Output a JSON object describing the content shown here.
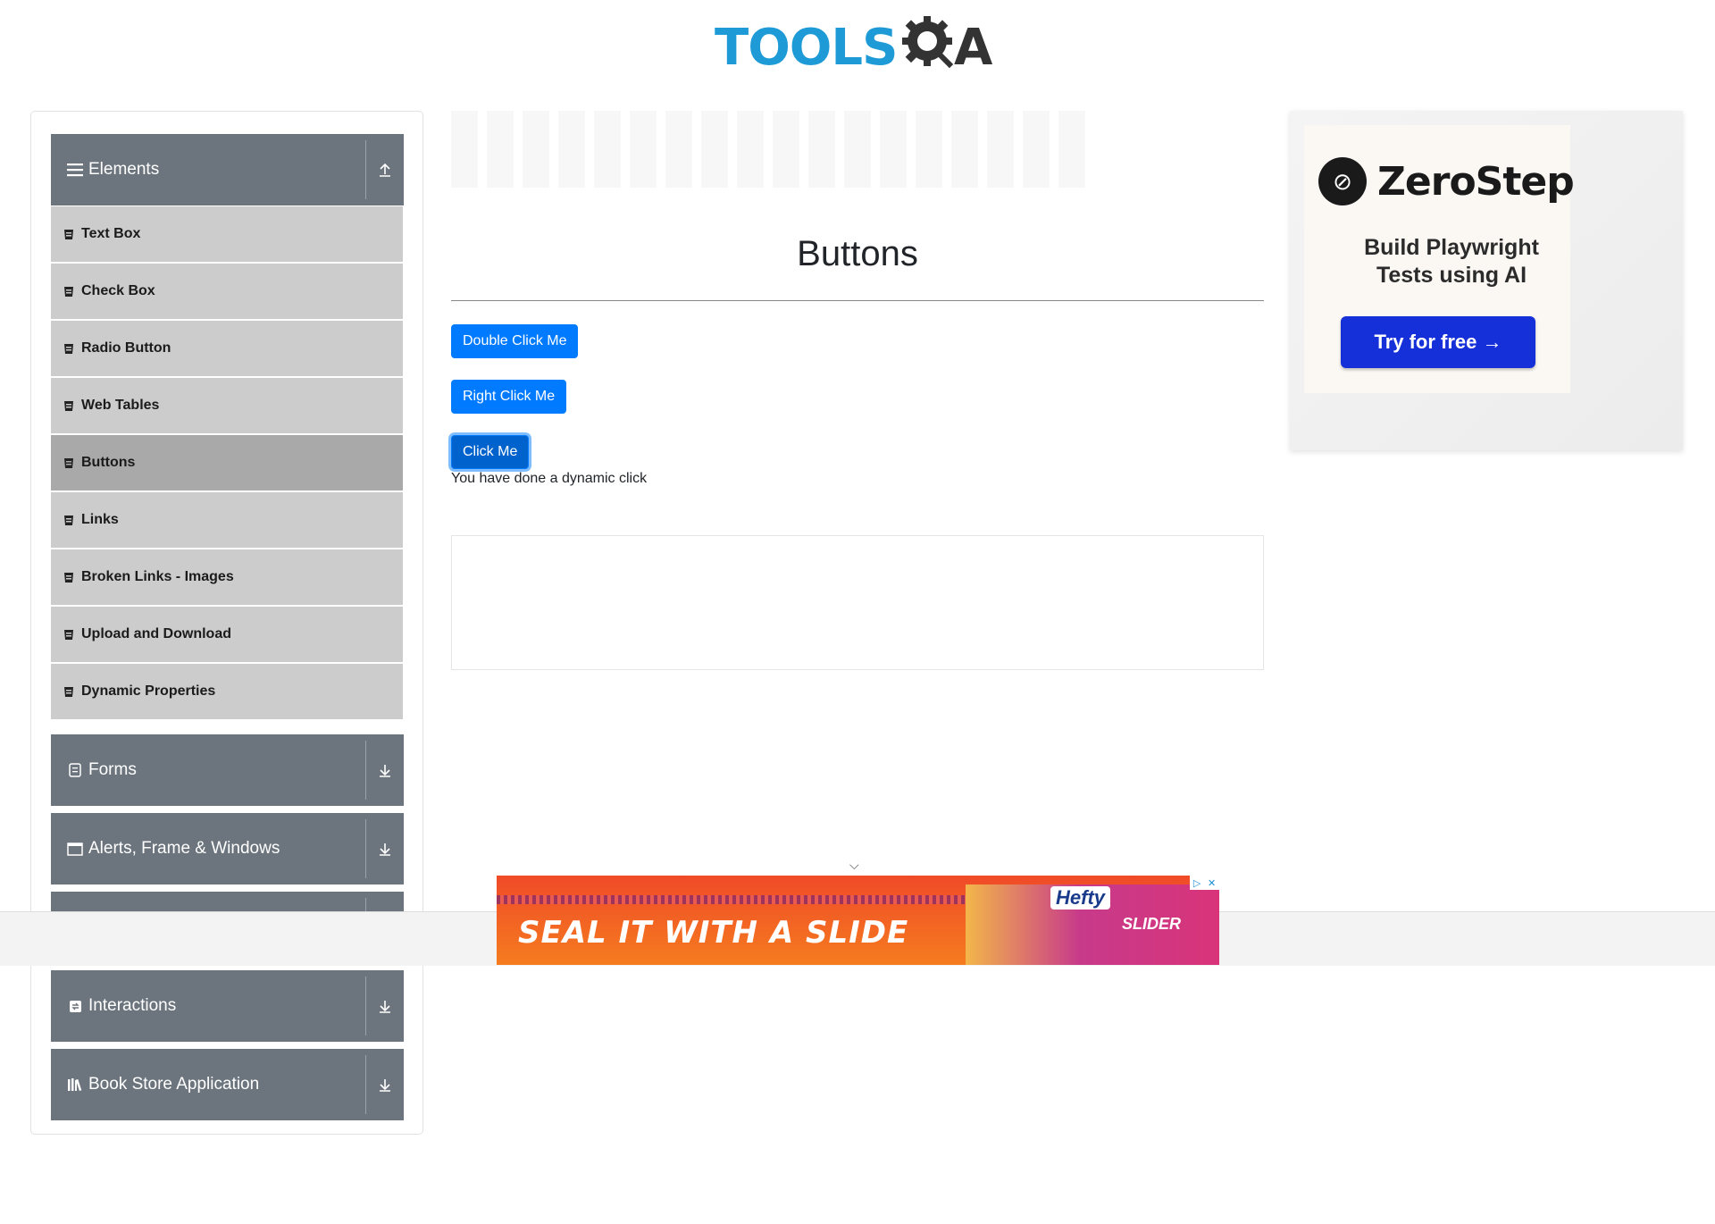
{
  "header": {
    "logo_word": "TOOLS",
    "logo_suffix": "A"
  },
  "sidebar": {
    "groups": [
      {
        "label": "Elements",
        "icon": "hamburger-icon",
        "expanded": true,
        "items": [
          "Text Box",
          "Check Box",
          "Radio Button",
          "Web Tables",
          "Buttons",
          "Links",
          "Broken Links - Images",
          "Upload and Download",
          "Dynamic Properties"
        ],
        "active_item": "Buttons"
      },
      {
        "label": "Forms",
        "icon": "form-icon",
        "expanded": false
      },
      {
        "label": "Alerts, Frame & Windows",
        "icon": "window-icon",
        "expanded": false
      },
      {
        "label": "Interactions",
        "icon": "interactions-icon",
        "expanded": false
      },
      {
        "label": "Book Store Application",
        "icon": "books-icon",
        "expanded": false
      }
    ]
  },
  "main": {
    "title": "Buttons",
    "double_click_label": "Double Click Me",
    "right_click_label": "Right Click Me",
    "click_label": "Click Me",
    "dynamic_message": "You have done a dynamic click"
  },
  "right_ad": {
    "brand": "ZeroStep",
    "tagline_line1": "Build Playwright",
    "tagline_line2": "Tests using AI",
    "cta": "Try for free →"
  },
  "bottom_ad": {
    "slogan": "SEAL IT WITH A SLIDE",
    "brand": "Hefty",
    "product": "SLIDER"
  },
  "colors": {
    "primary_button": "#007bff",
    "sidebar_header": "#6c757d",
    "sidebar_item": "#cccccc",
    "sidebar_item_active": "#a9a9a9",
    "logo_blue": "#1e9bd7"
  }
}
